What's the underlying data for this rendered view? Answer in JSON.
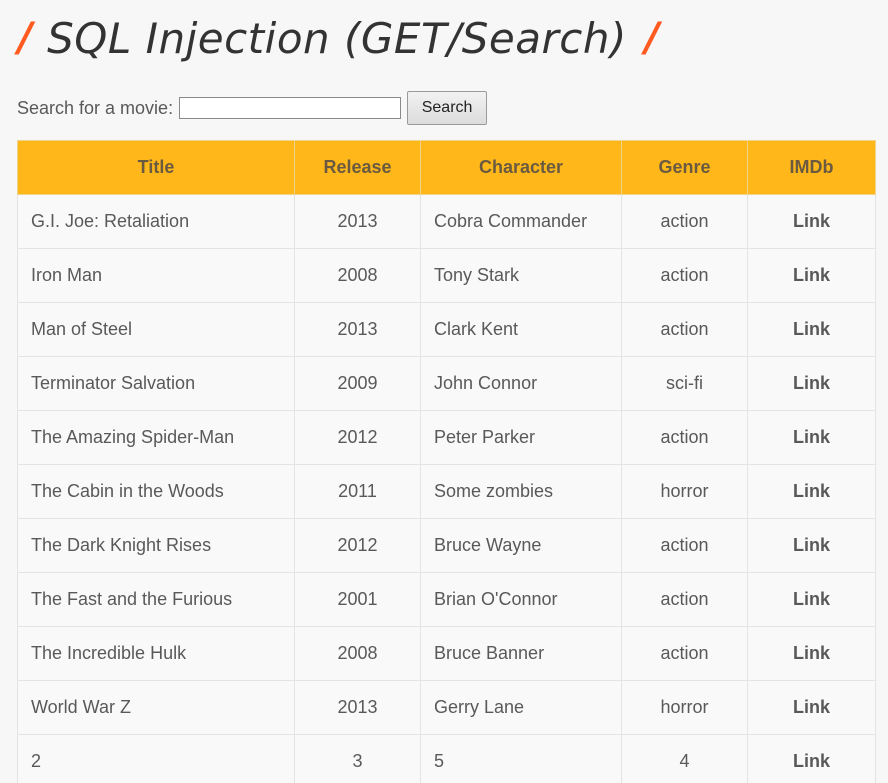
{
  "header": {
    "title": "SQL Injection (GET/Search)",
    "slash_left": "/",
    "slash_right": "/"
  },
  "search": {
    "label": "Search for a movie:",
    "value": "",
    "button_label": "Search"
  },
  "table": {
    "columns": [
      "Title",
      "Release",
      "Character",
      "Genre",
      "IMDb"
    ],
    "rows": [
      {
        "title": "G.I. Joe: Retaliation",
        "release": "2013",
        "character": "Cobra Commander",
        "genre": "action",
        "imdb": "Link"
      },
      {
        "title": "Iron Man",
        "release": "2008",
        "character": "Tony Stark",
        "genre": "action",
        "imdb": "Link"
      },
      {
        "title": "Man of Steel",
        "release": "2013",
        "character": "Clark Kent",
        "genre": "action",
        "imdb": "Link"
      },
      {
        "title": "Terminator Salvation",
        "release": "2009",
        "character": "John Connor",
        "genre": "sci-fi",
        "imdb": "Link"
      },
      {
        "title": "The Amazing Spider-Man",
        "release": "2012",
        "character": "Peter Parker",
        "genre": "action",
        "imdb": "Link"
      },
      {
        "title": "The Cabin in the Woods",
        "release": "2011",
        "character": "Some zombies",
        "genre": "horror",
        "imdb": "Link"
      },
      {
        "title": "The Dark Knight Rises",
        "release": "2012",
        "character": "Bruce Wayne",
        "genre": "action",
        "imdb": "Link"
      },
      {
        "title": "The Fast and the Furious",
        "release": "2001",
        "character": "Brian O'Connor",
        "genre": "action",
        "imdb": "Link"
      },
      {
        "title": "The Incredible Hulk",
        "release": "2008",
        "character": "Bruce Banner",
        "genre": "action",
        "imdb": "Link"
      },
      {
        "title": "World War Z",
        "release": "2013",
        "character": "Gerry Lane",
        "genre": "horror",
        "imdb": "Link"
      },
      {
        "title": "2",
        "release": "3",
        "character": "5",
        "genre": "4",
        "imdb": "Link"
      }
    ]
  },
  "colors": {
    "accent_slash": "#ff5a1f",
    "table_header": "#ffb719"
  }
}
